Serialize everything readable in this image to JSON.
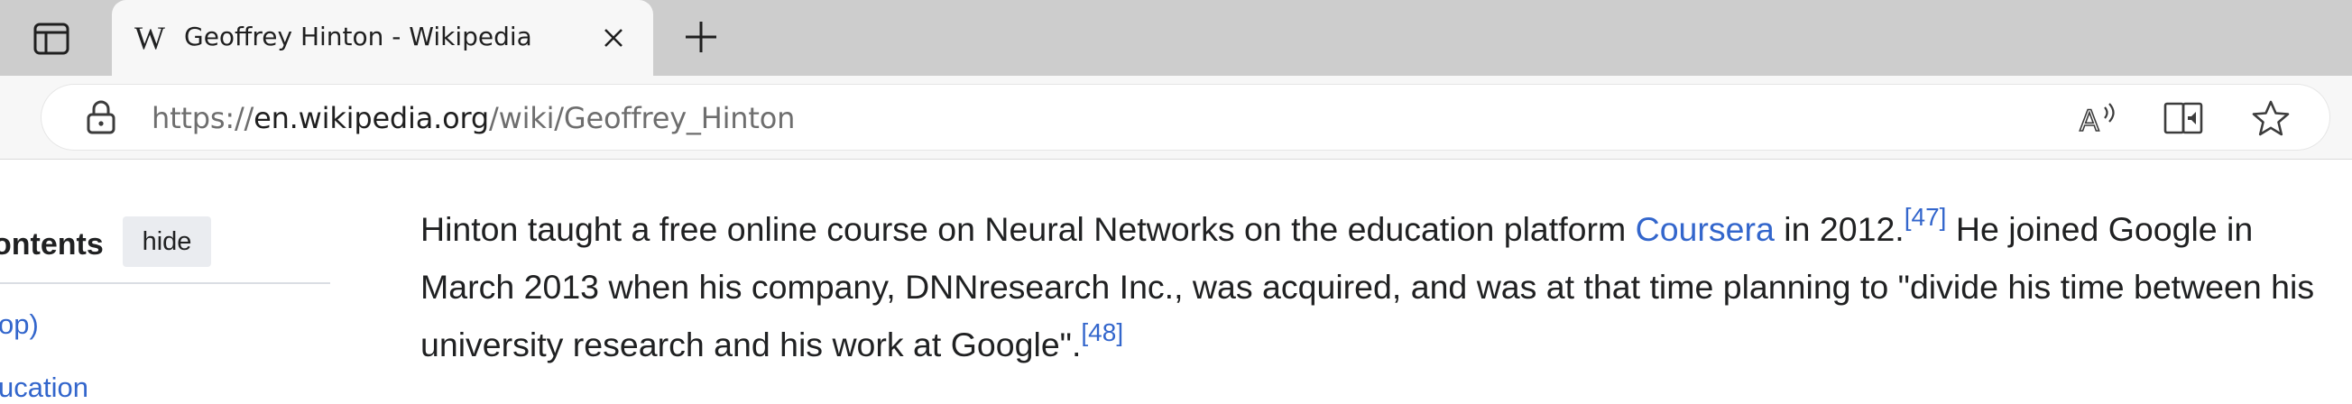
{
  "browser": {
    "tab": {
      "favicon": "W",
      "title": "Geoffrey Hinton - Wikipedia"
    },
    "icons": {
      "tab_actions": "tab-actions-icon",
      "close": "close-icon",
      "new_tab": "plus-icon",
      "lock": "lock-icon",
      "read_aloud": "read-aloud-icon",
      "immersive_reader": "immersive-reader-icon",
      "favorite": "star-icon"
    },
    "address_bar": {
      "scheme": "https://",
      "host": "en.wikipedia.org",
      "path": "/wiki/Geoffrey_Hinton"
    }
  },
  "sidebar": {
    "toc_title": "ontents",
    "hide_label": "hide",
    "items": [
      {
        "label": "op)"
      },
      {
        "label": "ucation"
      }
    ]
  },
  "article": {
    "p1_a": "Hinton taught a free online course on Neural Networks on the education platform ",
    "link_coursera": "Coursera",
    "p1_b": " in 2012.",
    "ref47": "[47]",
    "p1_c": " He joined Google in March 2013 when his company, DNNresearch Inc., was acquired, and was at that time planning to \"divide his time between his university research and his work at Google\".",
    "ref48": "[48]"
  },
  "colors": {
    "tab_strip": "#cdcdcd",
    "toolbar": "#f7f7f7",
    "link": "#3366cc",
    "text": "#202122"
  }
}
